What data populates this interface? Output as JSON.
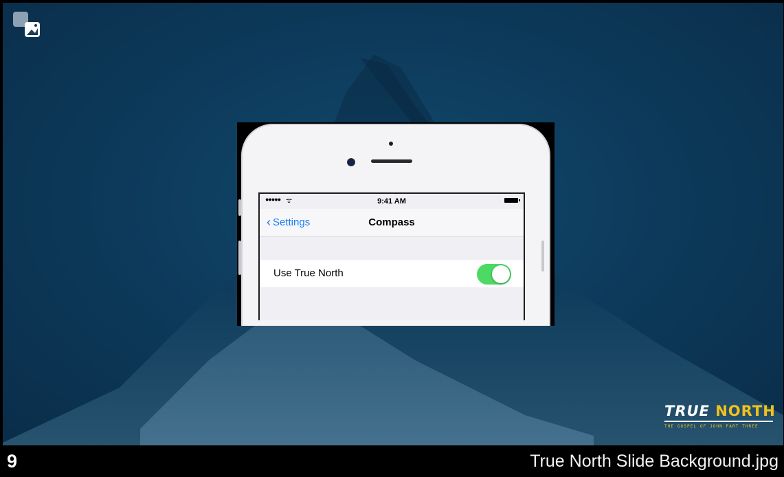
{
  "phone_screen": {
    "status_time": "9:41 AM",
    "signal_text": "●●●●●",
    "wifi_text": "ᯤ",
    "back_label": "Settings",
    "nav_title": "Compass",
    "setting_row_label": "Use True North",
    "toggle_on": true,
    "toggle_color": "#4cd964"
  },
  "logo": {
    "word1": "TRUE",
    "word2": "NORTH",
    "subtitle": "THE GOSPEL OF JOHN PART THREE",
    "accent_color": "#f2c21c"
  },
  "footer": {
    "slide_number": "9",
    "file_name": "True North Slide Background.jpg"
  },
  "icons": {
    "slide_type": "picture-icon"
  }
}
